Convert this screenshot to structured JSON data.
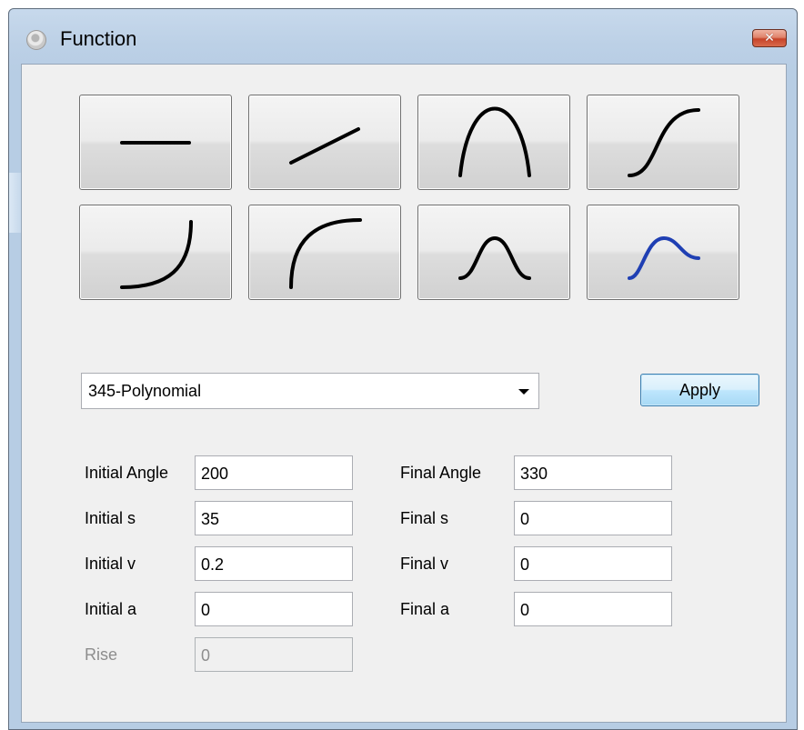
{
  "window": {
    "title": "Function",
    "close_label": "✕"
  },
  "function_buttons": [
    {
      "name": "constant"
    },
    {
      "name": "linear"
    },
    {
      "name": "parabola"
    },
    {
      "name": "s-curve"
    },
    {
      "name": "concave-up-curve"
    },
    {
      "name": "concave-down-curve"
    },
    {
      "name": "bell"
    },
    {
      "name": "polynomial-bell",
      "selected": true,
      "color": "#1f3fb3"
    }
  ],
  "function_select": {
    "value": "345-Polynomial"
  },
  "apply_label": "Apply",
  "initial": {
    "angle_label": "Initial Angle",
    "angle": "200",
    "s_label": "Initial s",
    "s": "35",
    "v_label": "Initial v",
    "v": "0.2",
    "a_label": "Initial a",
    "a": "0"
  },
  "final": {
    "angle_label": "Final Angle",
    "angle": "330",
    "s_label": "Final s",
    "s": "0",
    "v_label": "Final v",
    "v": "0",
    "a_label": "Final a",
    "a": "0"
  },
  "rise": {
    "label": "Rise",
    "value": "0",
    "disabled": true
  },
  "colors": {
    "curve": "#000000",
    "selected_curve": "#1f3fb3",
    "apply_border": "#3c7fb1"
  }
}
